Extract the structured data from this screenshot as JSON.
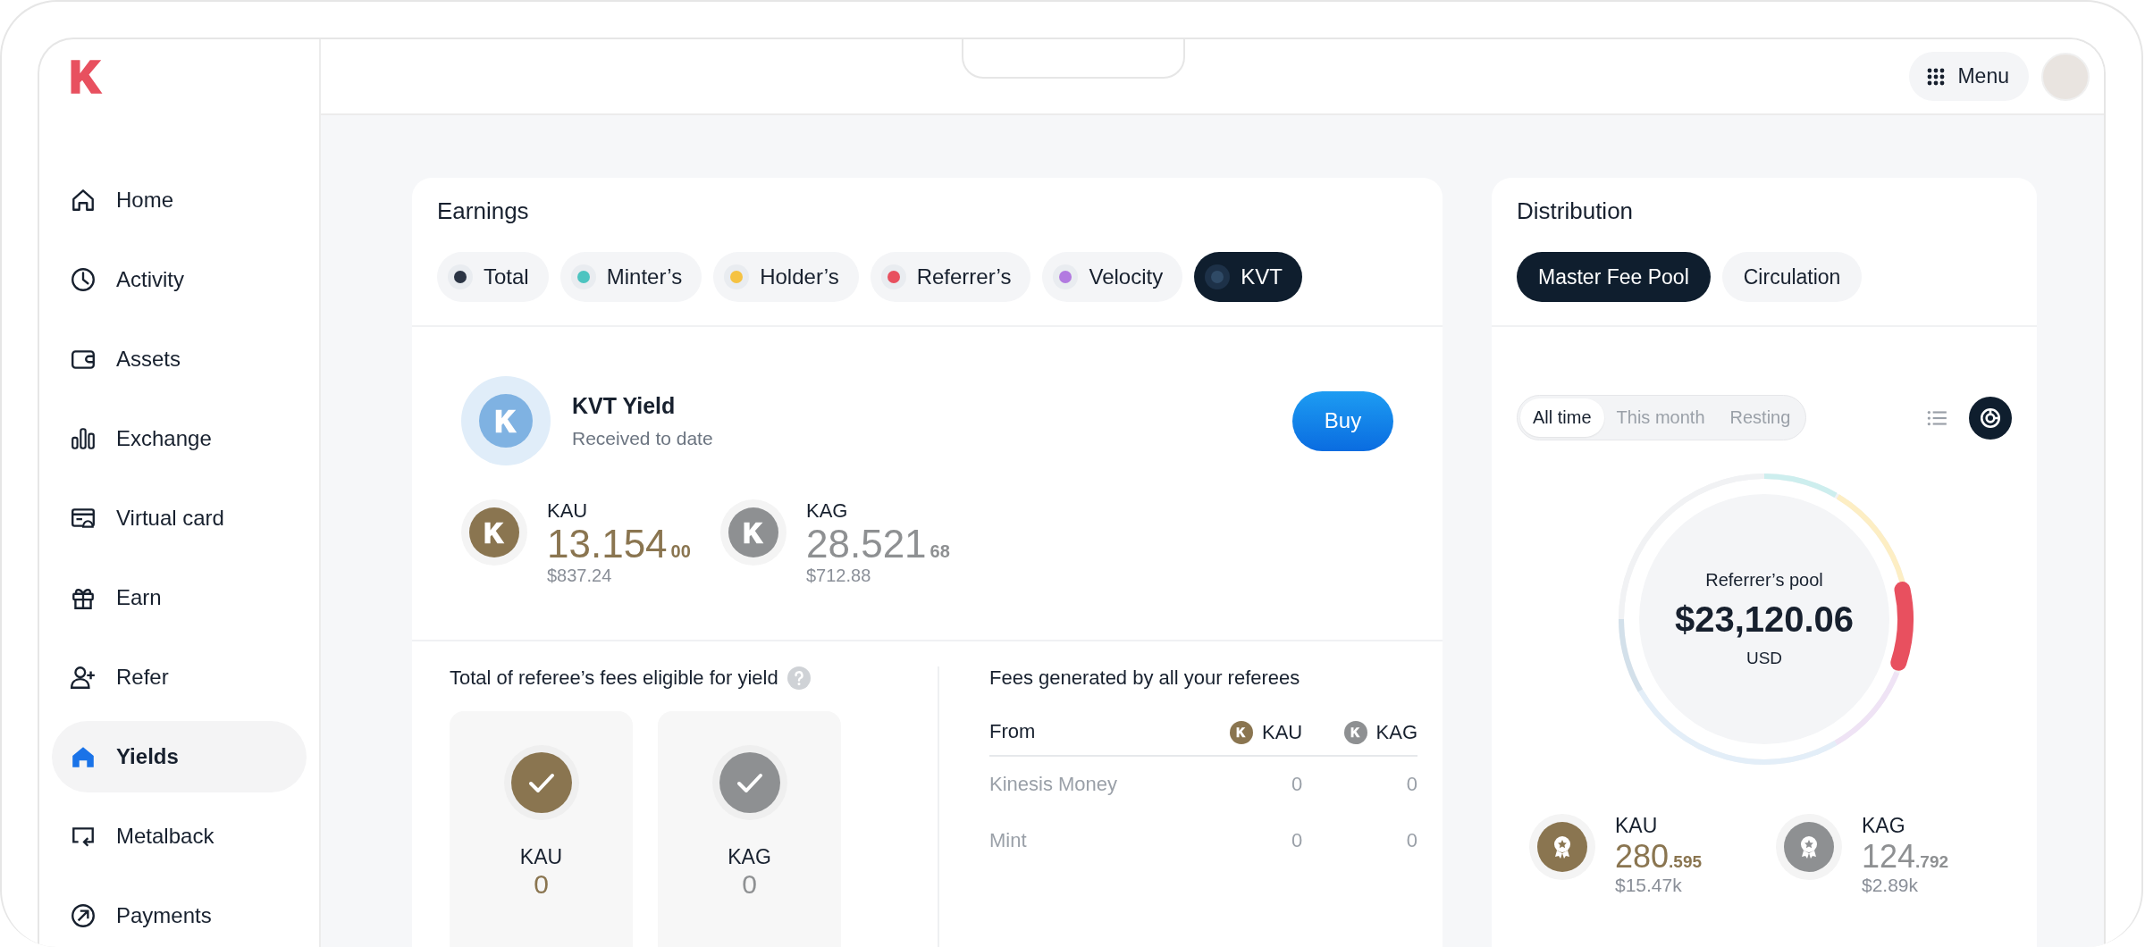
{
  "sidebar": {
    "items": [
      {
        "label": "Home",
        "selected": false
      },
      {
        "label": "Activity",
        "selected": false
      },
      {
        "label": "Assets",
        "selected": false
      },
      {
        "label": "Exchange",
        "selected": false
      },
      {
        "label": "Virtual card",
        "selected": false
      },
      {
        "label": "Earn",
        "selected": false
      },
      {
        "label": "Refer",
        "selected": false
      },
      {
        "label": "Yields",
        "selected": true
      },
      {
        "label": "Metalback",
        "selected": false
      },
      {
        "label": "Payments",
        "selected": false
      }
    ]
  },
  "header": {
    "menu_label": "Menu"
  },
  "earnings": {
    "title": "Earnings",
    "tabs": [
      {
        "label": "Total",
        "color": "#2b3444",
        "selected": false
      },
      {
        "label": "Minter’s",
        "color": "#4cc4c0",
        "selected": false
      },
      {
        "label": "Holder’s",
        "color": "#f5c242",
        "selected": false
      },
      {
        "label": "Referrer’s",
        "color": "#e8505f",
        "selected": false
      },
      {
        "label": "Velocity",
        "color": "#b27ae0",
        "selected": false
      },
      {
        "label": "KVT",
        "color": "#2f4a66",
        "selected": true
      }
    ],
    "yield": {
      "title": "KVT Yield",
      "subtitle": "Received to date",
      "button": "Buy"
    },
    "holdings": [
      {
        "symbol": "KAU",
        "whole": "13.154",
        "fraction": "00",
        "usd": "$837.24",
        "color": "#8a7550"
      },
      {
        "symbol": "KAG",
        "whole": "28.521",
        "fraction": "68",
        "usd": "$712.88",
        "color": "#8e9092"
      }
    ],
    "eligible": {
      "title": "Total of referee’s fees eligible for yield",
      "items": [
        {
          "symbol": "KAU",
          "value": "0",
          "color": "#8a7550",
          "checked": true
        },
        {
          "symbol": "KAG",
          "value": "0",
          "color": "#8e9092",
          "checked": true
        }
      ]
    },
    "fees": {
      "title": "Fees generated by all your referees",
      "columns": [
        {
          "label": "From"
        },
        {
          "label": "KAU",
          "color": "#8a7550"
        },
        {
          "label": "KAG",
          "color": "#8e9092"
        }
      ],
      "rows": [
        {
          "from": "Kinesis Money",
          "kau": "0",
          "kag": "0"
        },
        {
          "from": "Mint",
          "kau": "0",
          "kag": "0"
        }
      ]
    }
  },
  "distribution": {
    "title": "Distribution",
    "tabs": [
      {
        "label": "Master Fee Pool",
        "selected": true
      },
      {
        "label": "Circulation",
        "selected": false
      }
    ],
    "periods": [
      {
        "label": "All time",
        "selected": true
      },
      {
        "label": "This month",
        "selected": false
      },
      {
        "label": "Resting",
        "selected": false
      }
    ],
    "view_toggle": [
      {
        "kind": "list",
        "selected": false
      },
      {
        "kind": "donut",
        "selected": true
      }
    ],
    "pool": {
      "label": "Referrer’s pool",
      "amount": "$23,120.06",
      "currency": "USD"
    },
    "holdings": [
      {
        "symbol": "KAU",
        "whole": "280",
        "fraction": ".595",
        "usd": "$15.47k",
        "color": "#8a7550"
      },
      {
        "symbol": "KAG",
        "whole": "124",
        "fraction": ".792",
        "usd": "$2.89k",
        "color": "#8e9092"
      }
    ]
  }
}
